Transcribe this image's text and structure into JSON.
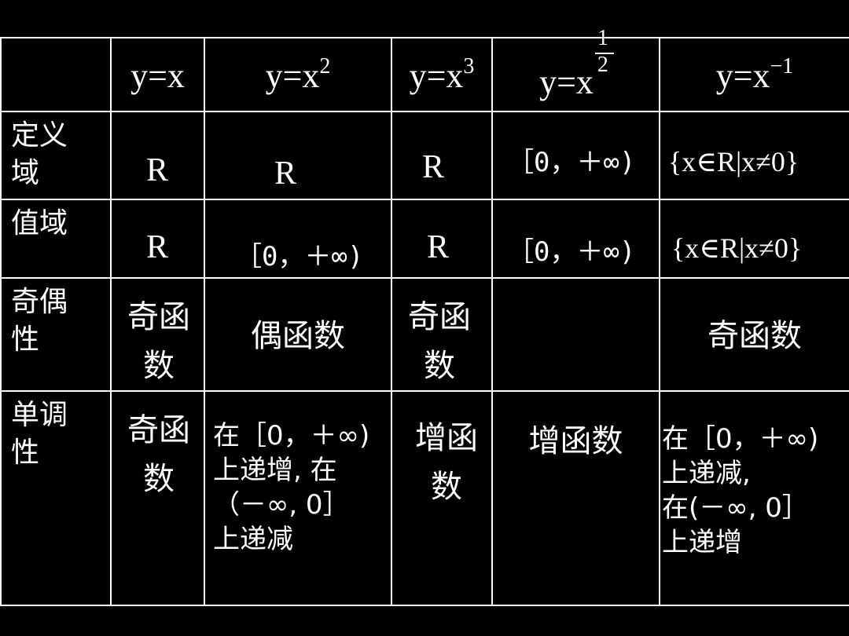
{
  "table": {
    "headers": {
      "corner": "",
      "f1": {
        "base": "y=x",
        "exponent": ""
      },
      "f2": {
        "base": "y=x",
        "exponent": "2"
      },
      "f3": {
        "base": "y=x",
        "exponent": "3"
      },
      "f4": {
        "base": "y=x",
        "exponent_numerator": "1",
        "exponent_denominator": "2"
      },
      "f5": {
        "base": "y=x",
        "exponent": "−1"
      }
    },
    "rows": {
      "domain": {
        "label": "定义域",
        "label_line1": "定义",
        "label_line2": "域",
        "f1": "R",
        "f2": "R",
        "f3": "R",
        "f4": "［0，＋∞)",
        "f5": "{x∈R|x≠0}"
      },
      "range": {
        "label": "值域",
        "f1": "R",
        "f2": "［0，＋∞)",
        "f3": "R",
        "f4": "［0，＋∞)",
        "f5": "{x∈R|x≠0}"
      },
      "parity": {
        "label": "奇偶性",
        "label_line1": "奇偶",
        "label_line2": "性",
        "f1_line1": "奇函",
        "f1_line2": "数",
        "f2": "偶函数",
        "f3_line1": "奇函",
        "f3_line2": "数",
        "f4": "",
        "f5": "奇函数"
      },
      "monotonicity": {
        "label": "单调性",
        "label_line1": "单调",
        "label_line2": "性",
        "f1_line1": "奇函",
        "f1_line2": "数",
        "f2_lines": [
          "在［0，＋∞)",
          "上递增, 在",
          "（－∞, 0］",
          "上递减"
        ],
        "f3_line1": "增函",
        "f3_line2": "数",
        "f4": "增函数",
        "f5_lines": [
          "在［0，＋∞)",
          "上递减,",
          "在(－∞, 0］",
          "上递增"
        ]
      }
    }
  }
}
